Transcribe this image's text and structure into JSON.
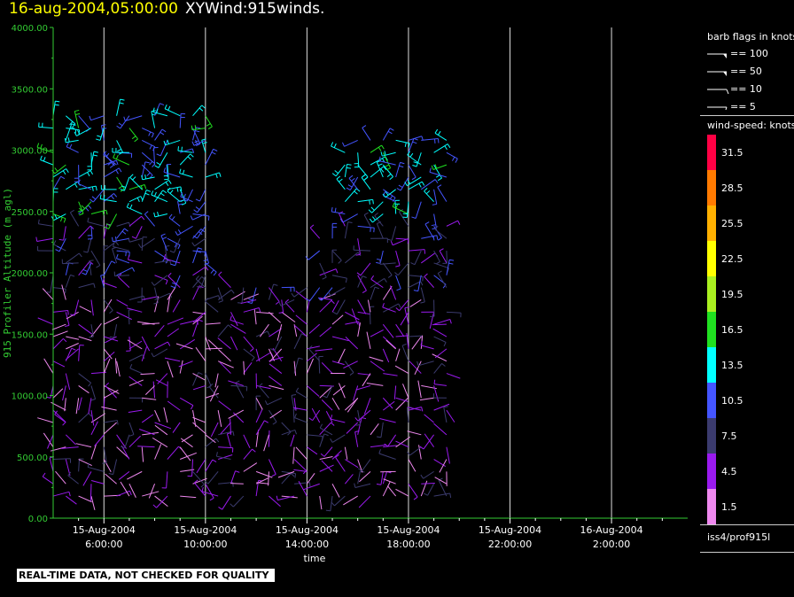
{
  "header": {
    "date_time": "16-aug-2004,05:00:00",
    "product": "XYWind:915winds."
  },
  "legend": {
    "barb_title": "barb flags in knots",
    "barb_entries": [
      {
        "value": 100,
        "label": "== 100"
      },
      {
        "value": 50,
        "label": "== 50"
      },
      {
        "value": 10,
        "label": "== 10"
      },
      {
        "value": 5,
        "label": "== 5"
      }
    ],
    "speed_title": "wind-speed: knots",
    "speed_scale": [
      {
        "value": "31.5",
        "color": "#ff0044"
      },
      {
        "value": "28.5",
        "color": "#ff7a00"
      },
      {
        "value": "25.5",
        "color": "#ffb000"
      },
      {
        "value": "22.5",
        "color": "#ffff00"
      },
      {
        "value": "19.5",
        "color": "#aaf020"
      },
      {
        "value": "16.5",
        "color": "#20e020"
      },
      {
        "value": "13.5",
        "color": "#00ffff"
      },
      {
        "value": "10.5",
        "color": "#4455ff"
      },
      {
        "value": "7.5",
        "color": "#3b3b6e"
      },
      {
        "value": "4.5",
        "color": "#9a1aee"
      },
      {
        "value": "1.5",
        "color": "#ee88ee"
      }
    ],
    "source": "iss4/prof915l"
  },
  "disclaimer": "REAL-TIME DATA, NOT CHECKED FOR QUALITY",
  "chart_data": {
    "type": "wind-barb",
    "title": "16-aug-2004,05:00:00  XYWind:915winds.",
    "xlabel": "time",
    "ylabel": "915 Profiler Altitude (m agl)",
    "ylim": [
      0,
      4000
    ],
    "y_ticks": [
      "0.00",
      "500.00",
      "1000.00",
      "1500.00",
      "2000.00",
      "2500.00",
      "3000.00",
      "3500.00",
      "4000.00"
    ],
    "x_range_hours": [
      4.0,
      29.0
    ],
    "x_ticks": [
      {
        "date": "15-Aug-2004",
        "time": "6:00:00",
        "hour": 6
      },
      {
        "date": "15-Aug-2004",
        "time": "10:00:00",
        "hour": 10
      },
      {
        "date": "15-Aug-2004",
        "time": "14:00:00",
        "hour": 14
      },
      {
        "date": "15-Aug-2004",
        "time": "18:00:00",
        "hour": 18
      },
      {
        "date": "15-Aug-2004",
        "time": "22:00:00",
        "hour": 22
      },
      {
        "date": "16-Aug-2004",
        "time": "2:00:00",
        "hour": 26
      }
    ],
    "data_hour_range": [
      4.0,
      19.5
    ],
    "gridlines": "vertical at major ticks",
    "background": "#000000"
  }
}
